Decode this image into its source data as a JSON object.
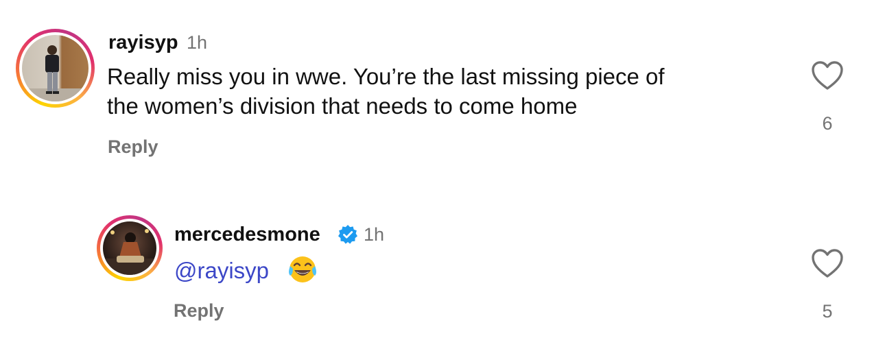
{
  "comments": [
    {
      "username": "rayisyp",
      "time": "1h",
      "text_line1": "Really miss you in wwe. You’re the last missing piece of",
      "text_line2": "the women’s division that needs to come home",
      "reply_label": "Reply",
      "like_count": "6",
      "verified": false
    },
    {
      "username": "mercedesmone",
      "time": "1h",
      "mention": "@rayisyp",
      "emoji": "face-with-tears-of-joy",
      "reply_label": "Reply",
      "like_count": "5",
      "verified": true
    }
  ],
  "icons": {
    "like": "heart-outline-icon",
    "verified": "verified-badge-icon"
  },
  "colors": {
    "mention": "#3c47c7",
    "verified": "#1d9bf0",
    "muted": "#737373",
    "text": "#111111"
  }
}
